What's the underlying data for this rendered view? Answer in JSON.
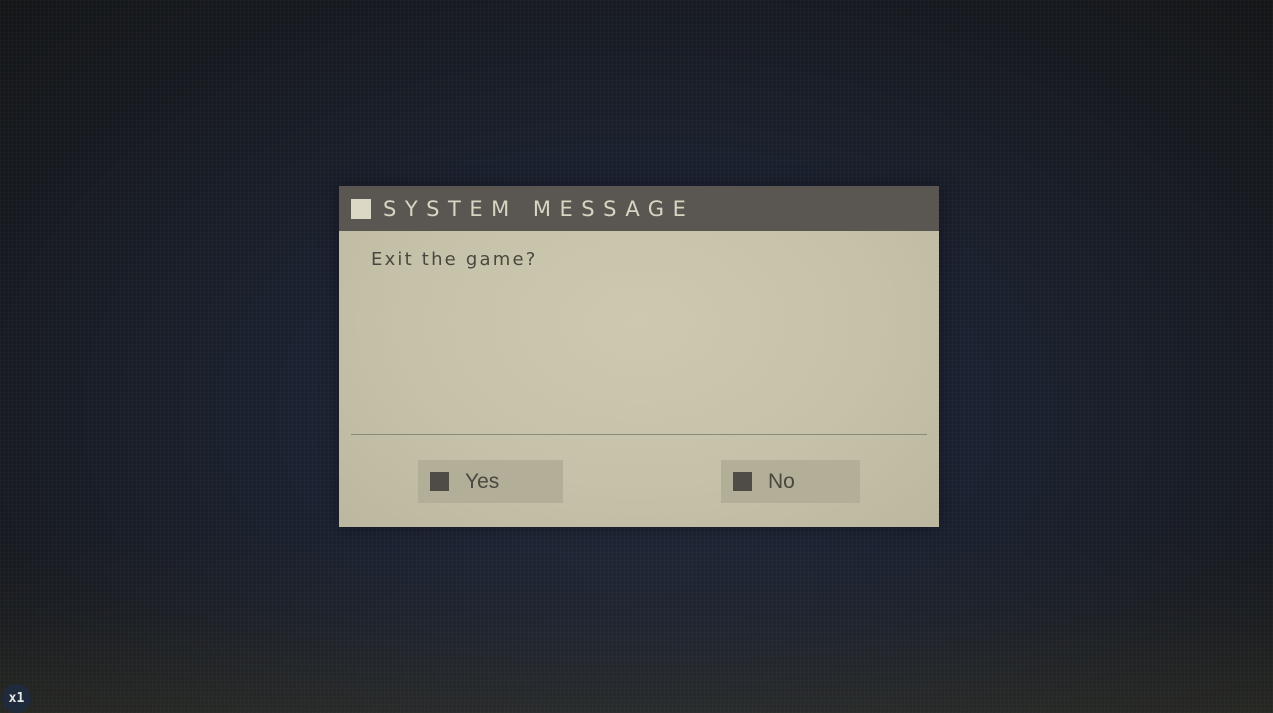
{
  "dialog": {
    "title": "SYSTEM MESSAGE",
    "message": "Exit the game?",
    "buttons": {
      "yes_label": "Yes",
      "no_label": "No"
    }
  },
  "overlay": {
    "speed_badge": "x1"
  },
  "colors": {
    "header_bg": "#5a5752",
    "panel_bg": "#c6c2aa",
    "button_bg": "#b3ae98",
    "button_marker": "#4f4c47",
    "text": "#4a4740"
  }
}
